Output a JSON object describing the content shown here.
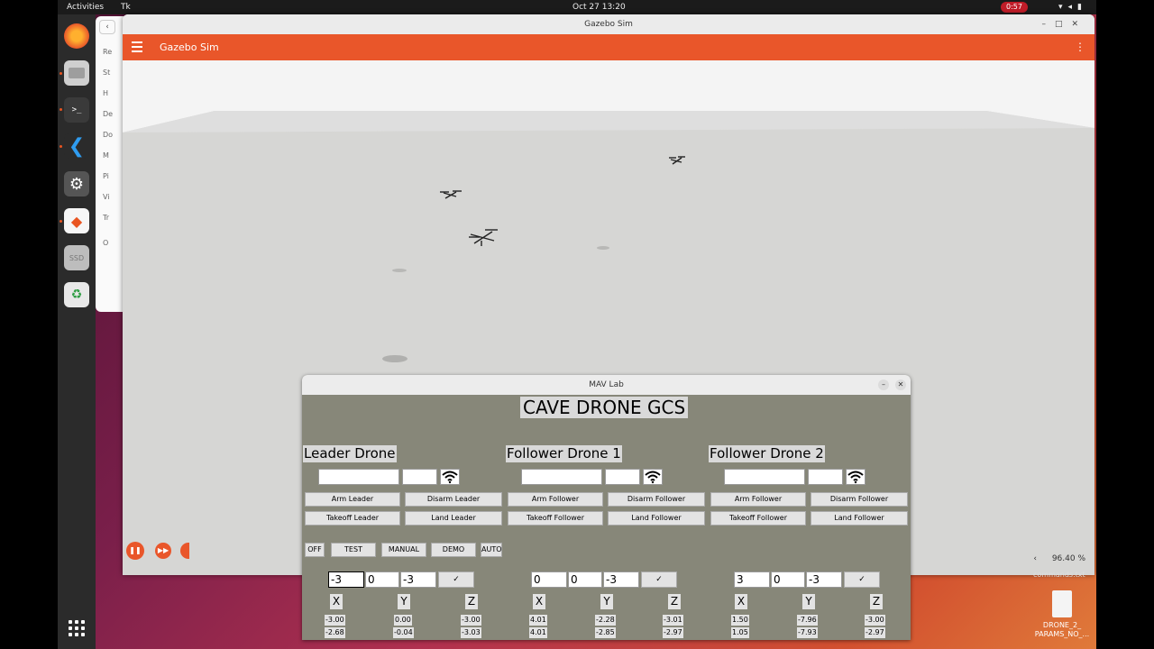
{
  "topbar": {
    "activities": "Activities",
    "app": "Tk",
    "clock": "Oct 27  13:20",
    "recording": "0:57"
  },
  "dock": {
    "apps": [
      "firefox-icon",
      "files-icon",
      "terminal-icon",
      "vscode-icon",
      "settings-icon",
      "qgroundcontrol-icon",
      "ssd-icon",
      "trash-icon"
    ]
  },
  "files_sidebar": {
    "items": [
      "Re",
      "St",
      "H",
      "De",
      "Do",
      "M",
      "Pi",
      "Vi",
      "Tr",
      "O"
    ]
  },
  "gazebo": {
    "window_title": "Gazebo Sim",
    "app_title": "Gazebo Sim",
    "zoom": "96.40 %"
  },
  "desktop": {
    "cmd_file": "commands.txt",
    "file_label": "DRONE_2_\nPARAMS_NO_..."
  },
  "mav": {
    "window_title": "MAV Lab",
    "header": "CAVE DRONE GCS",
    "drones": [
      {
        "title": "Leader Drone",
        "arm": "Arm Leader",
        "disarm": "Disarm Leader",
        "takeoff": "Takeoff Leader",
        "land": "Land Leader"
      },
      {
        "title": "Follower Drone 1",
        "arm": "Arm Follower",
        "disarm": "Disarm Follower",
        "takeoff": "Takeoff Follower",
        "land": "Land Follower"
      },
      {
        "title": "Follower Drone 2",
        "arm": "Arm Follower",
        "disarm": "Disarm Follower",
        "takeoff": "Takeoff Follower",
        "land": "Land Follower"
      }
    ],
    "modes": [
      "OFF",
      "TEST",
      "MANUAL",
      "DEMO",
      "AUTO"
    ],
    "targets": [
      {
        "x": "-3",
        "y": "0",
        "z": "-3"
      },
      {
        "x": "0",
        "y": "0",
        "z": "-3"
      },
      {
        "x": "3",
        "y": "0",
        "z": "-3"
      }
    ],
    "check": "✓",
    "axes": [
      "X",
      "Y",
      "Z"
    ],
    "readings": [
      {
        "x": [
          "-3.00",
          "-2.68"
        ],
        "y": [
          "0.00",
          "-0.04"
        ],
        "z": [
          "-3.00",
          "-3.03"
        ]
      },
      {
        "x": [
          "4.01",
          "4.01"
        ],
        "y": [
          "-2.28",
          "-2.85"
        ],
        "z": [
          "-3.01",
          "-2.97"
        ]
      },
      {
        "x": [
          "1.50",
          "1.05"
        ],
        "y": [
          "-7.96",
          "-7.93"
        ],
        "z": [
          "-3.00",
          "-2.97"
        ]
      }
    ]
  }
}
